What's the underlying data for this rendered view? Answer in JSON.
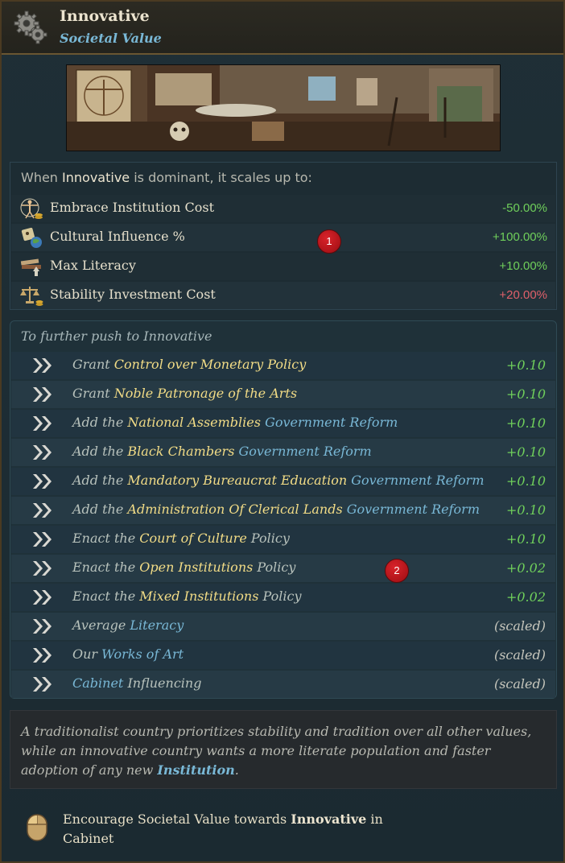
{
  "header": {
    "title": "Innovative",
    "subtitle": "Societal Value",
    "icon": "gear-icon"
  },
  "scale": {
    "intro_prefix": "When",
    "intro_value": "Innovative",
    "intro_suffix": "is dominant, it scales up to:",
    "rows": [
      {
        "label": "Embrace Institution Cost",
        "value": "-50.00%",
        "color": "#6fcf5b",
        "icon": "vitruvian-icon"
      },
      {
        "label": "Cultural Influence %",
        "value": "+100.00%",
        "color": "#6fcf5b",
        "icon": "culture-icon"
      },
      {
        "label": "Max Literacy",
        "value": "+10.00%",
        "color": "#6fcf5b",
        "icon": "books-icon"
      },
      {
        "label": "Stability Investment Cost",
        "value": "+20.00%",
        "color": "#e0606a",
        "icon": "scales-icon"
      }
    ]
  },
  "markers": {
    "one": "1",
    "two": "2"
  },
  "push": {
    "title": "To further push to Innovative",
    "rows": [
      {
        "pre": "Grant",
        "hl": "Control over Monetary Policy",
        "post": "",
        "val": "+0.10"
      },
      {
        "pre": "Grant",
        "hl": "Noble Patronage of the Arts",
        "post": "",
        "val": "+0.10"
      },
      {
        "pre": "Add the",
        "hl": "National Assemblies",
        "post": "Government Reform",
        "val": "+0.10"
      },
      {
        "pre": "Add the",
        "hl": "Black Chambers",
        "post": "Government Reform",
        "val": "+0.10"
      },
      {
        "pre": "Add the",
        "hl": "Mandatory Bureaucrat Education",
        "post": "Government Reform",
        "val": "+0.10"
      },
      {
        "pre": "Add the",
        "hl": "Administration Of Clerical Lands",
        "post": "Government Reform",
        "val": "+0.10"
      },
      {
        "pre": "Enact the",
        "hl": "Court of Culture",
        "post": "Policy",
        "val": "+0.10"
      },
      {
        "pre": "Enact the",
        "hl": "Open Institutions",
        "post": "Policy",
        "val": "+0.02"
      },
      {
        "pre": "Enact the",
        "hl": "Mixed Institutions",
        "post": "Policy",
        "val": "+0.02"
      },
      {
        "pre": "Average",
        "bl": "Literacy",
        "post": "",
        "val": "(scaled)"
      },
      {
        "pre": "Our",
        "bl": "Works of Art",
        "post": "",
        "val": "(scaled)"
      },
      {
        "pre": "",
        "bl": "Cabinet",
        "post": "Influencing",
        "val": "(scaled)"
      }
    ]
  },
  "description": {
    "text": "A traditionalist country prioritizes stability and tradition over all other values, while an innovative country wants a more literate population and faster adoption of any new",
    "link": "Institution",
    "end": "."
  },
  "footer": {
    "prefix": "Encourage Societal Value towards",
    "value": "Innovative",
    "suffix": "in Cabinet",
    "icon": "mouse-icon"
  }
}
